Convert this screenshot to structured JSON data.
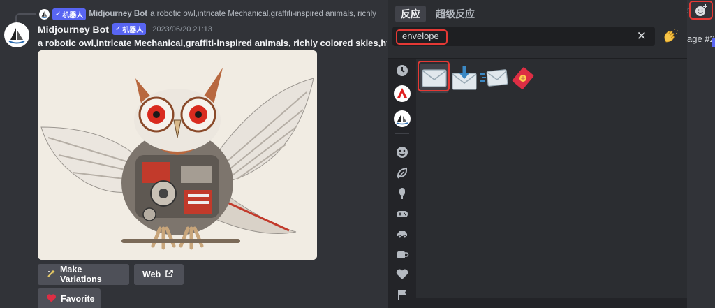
{
  "message": {
    "reply": {
      "author": "Midjourney Bot",
      "bot_tag": "机器人",
      "text": "a robotic owl,intricate Mechanical,graffiti-inspired animals, richly"
    },
    "author": "Midjourney Bot",
    "bot_tag": "机器人",
    "timestamp": "2023/06/20 21:13",
    "prompt": "a robotic owl,intricate Mechanical,graffiti-inspired animals, richly colored skies,hy",
    "right_peek": "age #2",
    "right_peek_top": "5,",
    "buttons": {
      "variations": "Make Variations",
      "web": "Web",
      "favorite": "Favorite"
    }
  },
  "picker": {
    "tabs": [
      "反应",
      "超级反应"
    ],
    "search": {
      "value": "envelope"
    },
    "results": [
      "envelope",
      "envelope-with-arrow",
      "incoming-envelope",
      "red-envelope"
    ],
    "rail_icons": [
      "clock-icon",
      "server-a-icon",
      "server-sailboat-icon",
      "smile-icon",
      "leaf-icon",
      "ice-pop-icon",
      "gamepad-icon",
      "car-icon",
      "coffee-icon",
      "heart-icon",
      "flag-icon"
    ]
  },
  "colors": {
    "background": "#313338",
    "picker": "#2b2d31",
    "rail": "#232428",
    "accent": "#5865f2",
    "highlight": "#e53935"
  }
}
